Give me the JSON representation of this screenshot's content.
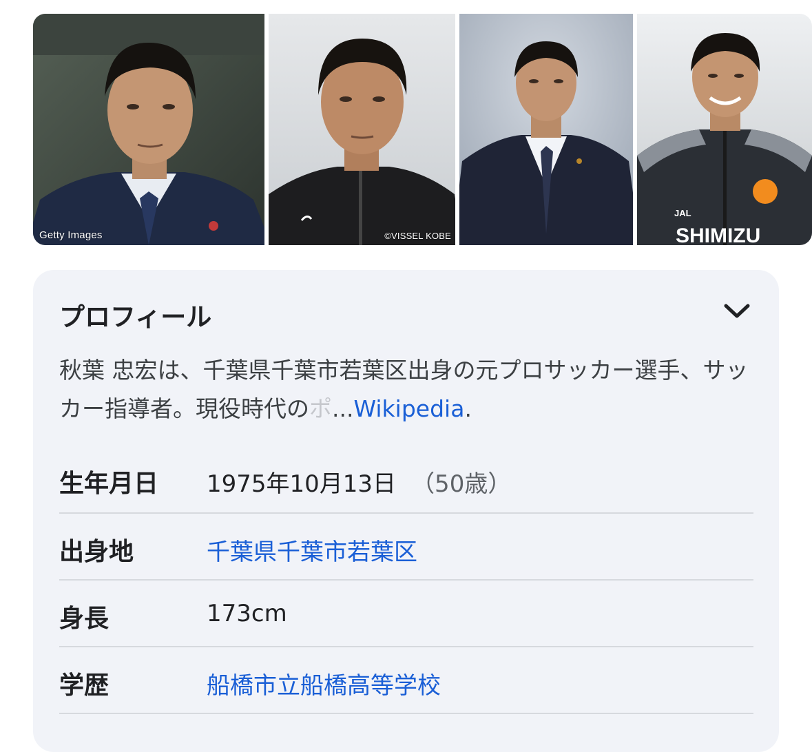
{
  "gallery": {
    "images": [
      {
        "name": "photo-suit-getty",
        "credit": "Getty Images"
      },
      {
        "name": "photo-vissel-kobe",
        "credit": "©VISSEL KOBE"
      },
      {
        "name": "photo-suit-grey-background",
        "credit": ""
      },
      {
        "name": "photo-shimizu-jersey",
        "jersey_text": "SHIMIZU",
        "sponsor_text": "JAL"
      }
    ]
  },
  "profile": {
    "title": "プロフィール",
    "description_text": "秋葉 忠宏は、千葉県千葉市若葉区出身の元プロサッカー選手、サッカー指導者。現役時代の",
    "description_fade": "ポ",
    "ellipsis": "...",
    "source_link": "Wikipedia",
    "source_suffix": ".",
    "rows": [
      {
        "label": "生年月日",
        "value": "1975年10月13日",
        "extra": "（50歳）",
        "link": false
      },
      {
        "label": "出身地",
        "value": "千葉県千葉市若葉区",
        "link": true
      },
      {
        "label": "身長",
        "value": "173cm",
        "link": false
      },
      {
        "label": "学歴",
        "value": "船橋市立船橋高等学校",
        "link": true
      }
    ]
  },
  "colors": {
    "link": "#1a5fd6",
    "card_background": "#f1f3f8",
    "divider": "#d6d9de"
  },
  "icons": {
    "expand": "chevron-down-icon"
  }
}
